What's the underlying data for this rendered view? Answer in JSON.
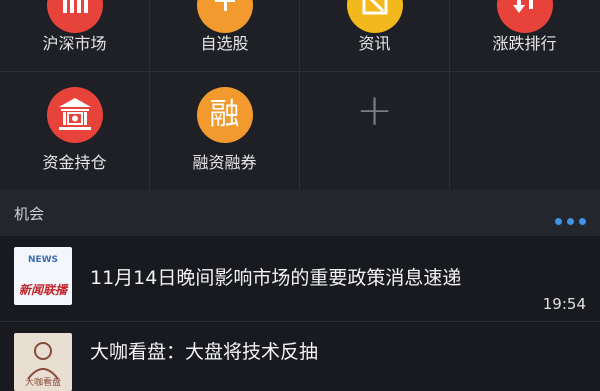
{
  "menu": [
    {
      "label": "沪深市场",
      "icon": "hs-market-icon",
      "color": "#e8433a"
    },
    {
      "label": "自选股",
      "icon": "watchlist-icon",
      "color": "#f29a2e"
    },
    {
      "label": "资讯",
      "icon": "news-icon",
      "color": "#f2b81c"
    },
    {
      "label": "涨跌排行",
      "icon": "ranking-icon",
      "color": "#e8433a"
    },
    {
      "label": "资金持仓",
      "icon": "bank-icon",
      "color": "#e8433a"
    },
    {
      "label": "融资融券",
      "icon": "margin-icon",
      "glyph": "融",
      "color": "#f29a2e"
    },
    {
      "label": "",
      "icon": "add-icon",
      "glyph": "+"
    }
  ],
  "section": {
    "title": "机会"
  },
  "news": [
    {
      "headline": "11月14日晚间影响市场的重要政策消息速递",
      "time": "19:54",
      "thumb_text": "新闻联播",
      "thumb_sub": "NEWS"
    },
    {
      "headline": "大咖看盘：大盘将技术反抽",
      "time": "",
      "thumb_text": "大咖看盘"
    }
  ]
}
